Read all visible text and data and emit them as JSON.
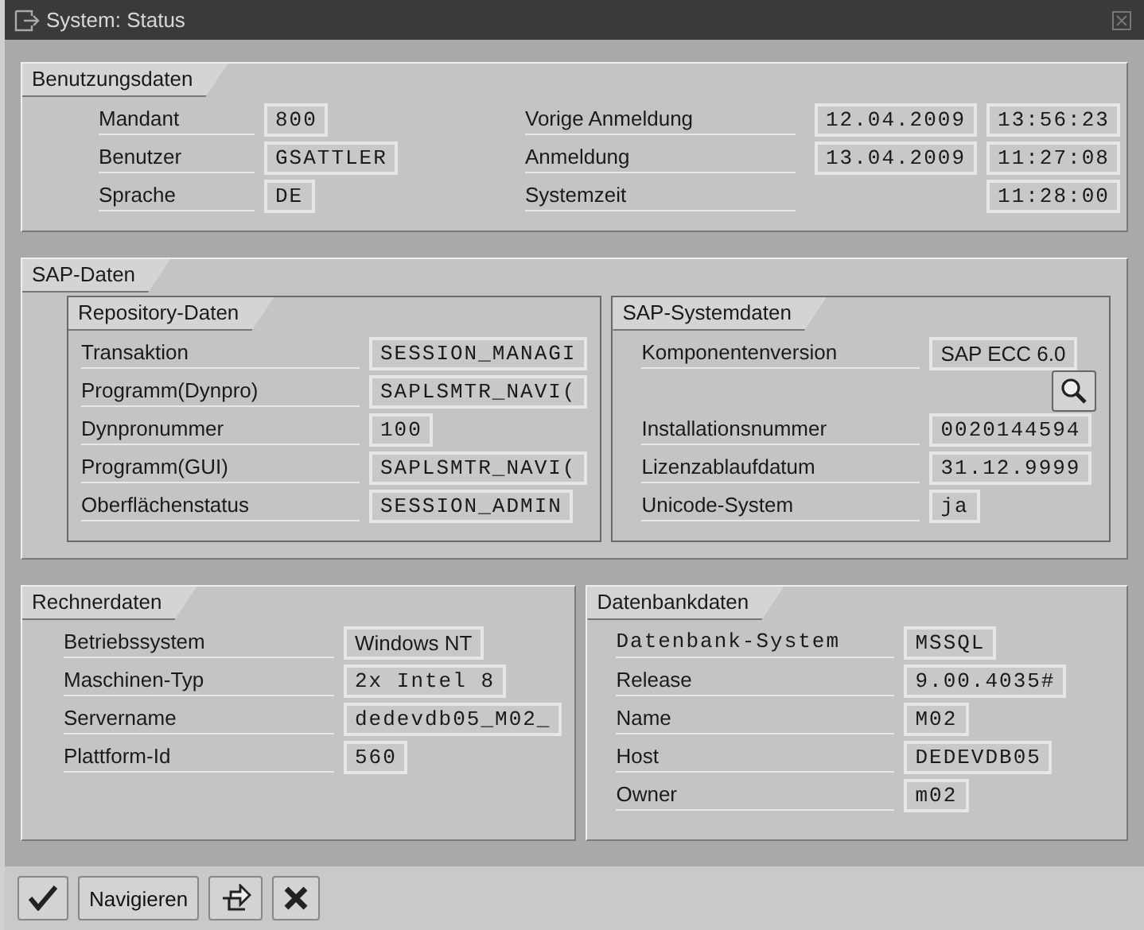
{
  "window": {
    "title": "System: Status"
  },
  "usage": {
    "title": "Benutzungsdaten",
    "left": [
      {
        "label": "Mandant",
        "value": "800"
      },
      {
        "label": "Benutzer",
        "value": "GSATTLER"
      },
      {
        "label": "Sprache",
        "value": "DE"
      }
    ],
    "right": [
      {
        "label": "Vorige Anmeldung",
        "values": [
          "12.04.2009",
          "13:56:23"
        ]
      },
      {
        "label": "Anmeldung",
        "values": [
          "13.04.2009",
          "11:27:08"
        ]
      },
      {
        "label": "Systemzeit",
        "values": [
          "11:28:00"
        ]
      }
    ]
  },
  "sap": {
    "title": "SAP-Daten",
    "repository": {
      "title": "Repository-Daten",
      "rows": [
        {
          "kind": "field",
          "label": "Transaktion",
          "value": "SESSION_MANAGI"
        },
        {
          "kind": "field",
          "label": "Programm(Dynpro)",
          "value": "SAPLSMTR_NAVI("
        },
        {
          "kind": "field",
          "label": "Dynpronummer",
          "value": "100"
        },
        {
          "kind": "field",
          "label": "Programm(GUI)",
          "value": "SAPLSMTR_NAVI("
        },
        {
          "kind": "field",
          "label": "Oberflächenstatus",
          "value": "SESSION_ADMIN"
        }
      ]
    },
    "system": {
      "title": "SAP-Systemdaten",
      "rows": [
        {
          "kind": "field",
          "label": "Komponentenversion",
          "value": "SAP ECC 6.0",
          "proportional": true
        },
        {
          "kind": "button"
        },
        {
          "kind": "field",
          "label": "Installationsnummer",
          "value": "0020144594"
        },
        {
          "kind": "field",
          "label": "Lizenzablaufdatum",
          "value": "31.12.9999"
        },
        {
          "kind": "field",
          "label": "Unicode-System",
          "value": "ja"
        }
      ]
    }
  },
  "host": {
    "title": "Rechnerdaten",
    "rows": [
      {
        "kind": "field",
        "label": "Betriebssystem",
        "value": "Windows NT",
        "proportional": true
      },
      {
        "kind": "field",
        "label": "Maschinen-Typ",
        "value": "2x Intel 8"
      },
      {
        "kind": "field",
        "label": "Servername",
        "value": "dedevdb05_M02_"
      },
      {
        "kind": "field",
        "label": "Plattform-Id",
        "value": "560"
      }
    ]
  },
  "database": {
    "title": "Datenbankdaten",
    "rows": [
      {
        "kind": "field",
        "label": "Datenbank-System",
        "value": "MSSQL",
        "mono_label": true
      },
      {
        "kind": "field",
        "label": "Release",
        "value": "9.00.4035#"
      },
      {
        "kind": "field",
        "label": "Name",
        "value": "M02"
      },
      {
        "kind": "field",
        "label": "Host",
        "value": "DEDEVDB05"
      },
      {
        "kind": "field",
        "label": "Owner",
        "value": "m02"
      }
    ]
  },
  "toolbar": [
    {
      "kind": "confirm"
    },
    {
      "kind": "text",
      "label": "Navigieren"
    },
    {
      "kind": "export"
    },
    {
      "kind": "cancel"
    }
  ]
}
